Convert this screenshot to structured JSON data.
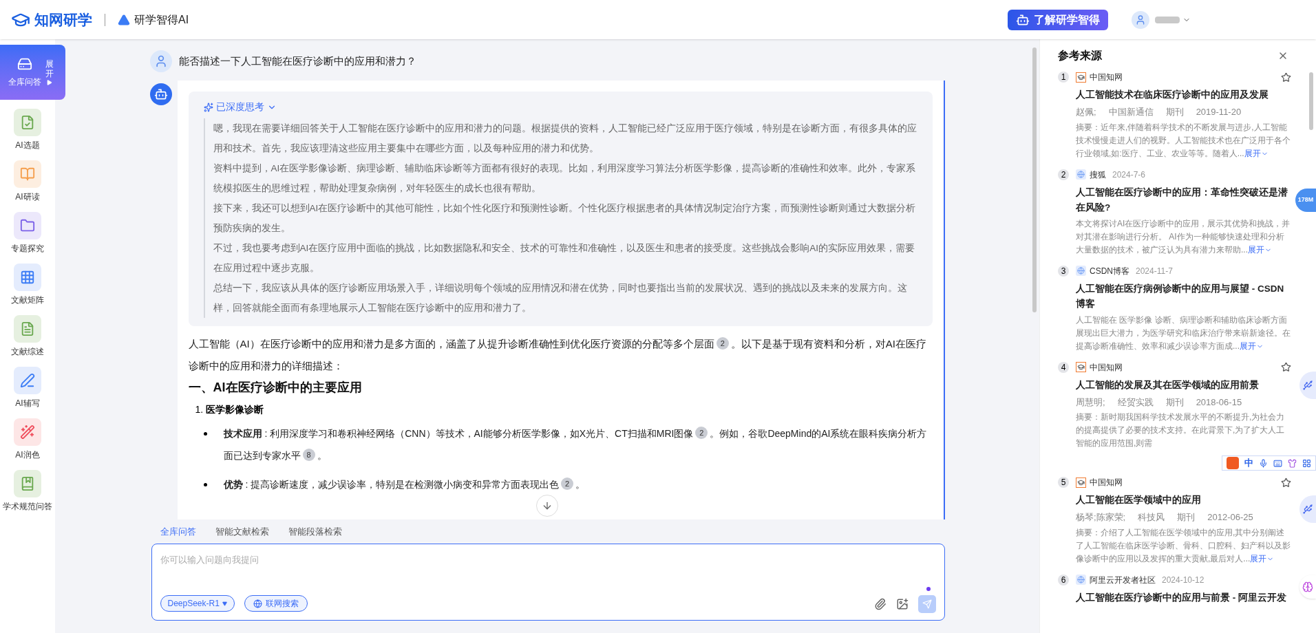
{
  "header": {
    "logo_text": "知网研学",
    "product": "研学智得AI",
    "promo_button": "了解研学智得"
  },
  "sidebar": {
    "expand_label": "展开",
    "items": [
      {
        "label": "全库问答",
        "kind": "library",
        "selected": true
      },
      {
        "label": "AI选题",
        "kind": "topic",
        "selected": false
      },
      {
        "label": "AI研读",
        "kind": "read",
        "selected": false
      },
      {
        "label": "专题探究",
        "kind": "folder",
        "selected": false
      },
      {
        "label": "文献矩阵",
        "kind": "matrix",
        "selected": false
      },
      {
        "label": "文献综述",
        "kind": "review",
        "selected": false
      },
      {
        "label": "AI辅写",
        "kind": "write",
        "selected": false
      },
      {
        "label": "AI润色",
        "kind": "polish",
        "selected": false
      },
      {
        "label": "学术规范问答",
        "kind": "norm",
        "selected": false
      }
    ]
  },
  "chat": {
    "question": "能否描述一下人工智能在医疗诊断中的应用和潜力？",
    "thinking": {
      "label": "已深度思考",
      "expanded": true,
      "paragraphs": [
        "嗯，我现在需要详细回答关于人工智能在医疗诊断中的应用和潜力的问题。根据提供的资料，人工智能已经广泛应用于医疗领域，特别是在诊断方面，有很多具体的应用和技术。首先，我应该理清这些应用主要集中在哪些方面，以及每种应用的潜力和优势。",
        "资料中提到，AI在医学影像诊断、病理诊断、辅助临床诊断等方面都有很好的表现。比如，利用深度学习算法分析医学影像，提高诊断的准确性和效率。此外，专家系统模拟医生的思维过程，帮助处理复杂病例，对年轻医生的成长也很有帮助。",
        "接下来，我还可以想到AI在医疗诊断中的其他可能性，比如个性化医疗和预测性诊断。个性化医疗根据患者的具体情况制定治疗方案，而预测性诊断则通过大数据分析预防疾病的发生。",
        "不过，我也要考虑到AI在医疗应用中面临的挑战，比如数据隐私和安全、技术的可靠性和准确性，以及医生和患者的接受度。这些挑战会影响AI的实际应用效果，需要在应用过程中逐步克服。",
        "总结一下，我应该从具体的医疗诊断应用场景入手，详细说明每个领域的应用情况和潜在优势，同时也要指出当前的发展状况、遇到的挑战以及未来的发展方向。这样，回答就能全面而有条理地展示人工智能在医疗诊断中的应用和潜力了。"
      ]
    },
    "answer": [
      {
        "kind": "paragraph",
        "segments": [
          {
            "text": "人工智能（AI）在医疗诊断中的应用和潜力是多方面的，涵盖了从提升诊断准确性到优化医疗资源的分配等多个层面"
          },
          {
            "cite": "2"
          },
          {
            "text": "。以下是基于现有资料和分析，对AI在医疗诊断中的应用和潜力的详细描述："
          }
        ]
      },
      {
        "kind": "heading",
        "text": "一、AI在医疗诊断中的主要应用"
      },
      {
        "kind": "numbered",
        "number": "1.",
        "text": "医学影像诊断"
      },
      {
        "kind": "bullet",
        "term": "技术应用",
        "segments": [
          {
            "text": " : 利用深度学习和卷积神经网络（CNN）等技术，AI能够分析医学影像，如X光片、CT扫描和MRI图像"
          },
          {
            "cite": "2"
          },
          {
            "text": "。例如，谷歌DeepMind的AI系统在眼科疾病分析方面已达到专家水平"
          },
          {
            "cite": "8"
          },
          {
            "text": "。"
          }
        ]
      },
      {
        "kind": "bullet",
        "term": "优势",
        "segments": [
          {
            "text": " : 提高诊断速度，减少误诊率，特别是在检测微小病变和异常方面表现出色"
          },
          {
            "cite": "2"
          },
          {
            "text": "。"
          }
        ]
      }
    ]
  },
  "composer": {
    "tabs": [
      {
        "label": "全库问答",
        "selected": true
      },
      {
        "label": "智能文献检索",
        "selected": false
      },
      {
        "label": "智能段落检索",
        "selected": false
      }
    ],
    "placeholder": "你可以输入问题向我提问",
    "model": "DeepSeek-R1",
    "web_search": "联网搜索"
  },
  "references": {
    "title": "参考来源",
    "items": [
      {
        "number": "1",
        "kind": "cnki",
        "source": "中国知网",
        "starred": false,
        "title": "人工智能技术在临床医疗诊断中的应用及发展",
        "meta": [
          "赵佩;",
          "中国新通信",
          "期刊",
          "2019-11-20"
        ],
        "abstract": "摘要：近年来,伴随着科学技术的不断发展与进步,人工智能技术慢慢走进人们的视野。人工智能技术也在广泛用于各个行业领域,如:医疗、工业、农业等等。随着人...",
        "expand": "展开"
      },
      {
        "number": "2",
        "kind": "web",
        "source": "搜狐",
        "date": "2024-7-6",
        "title": "人工智能在医疗诊断中的应用：革命性突破还是潜在风险?",
        "abstract": "本文将探讨AI在医疗诊断中的应用，展示其优势和挑战，并对其潜在影响进行分析。 AI作为一种能够快速处理和分析大量数据的技术，被广泛认为具有潜力来帮助...",
        "expand": "展开"
      },
      {
        "number": "3",
        "kind": "web",
        "source": "CSDN博客",
        "date": "2024-11-7",
        "title": "人工智能在医疗病例诊断中的应用与展望 - CSDN博客",
        "abstract": "人工智能在 医学影像 诊断、病理诊断和辅助临床诊断方面展现出巨大潜力，为医学研究和临床治疗带来崭新途径。在提高诊断准确性、效率和减少误诊率方面成...",
        "expand": "展开"
      },
      {
        "number": "4",
        "kind": "cnki",
        "source": "中国知网",
        "starred": false,
        "title": "人工智能的发展及其在医学领域的应用前景",
        "meta": [
          "周慧明;",
          "经贸实践",
          "期刊",
          "2018-06-15"
        ],
        "abstract": "摘要：新时期我国科学技术发展水平的不断提升,为社会力的提高提供了必要的技术支持。在此背景下,为了扩大人工智能的应用范围,则需"
      },
      {
        "number": "5",
        "kind": "cnki",
        "source": "中国知网",
        "starred": false,
        "title": "人工智能在医学领域中的应用",
        "meta": [
          "杨琴;陈家荣;",
          "科技风",
          "期刊",
          "2012-06-25"
        ],
        "abstract": "摘要：介绍了人工智能在医学领域中的应用,其中分别阐述了人工智能在临床医学诊断、骨科、口腔科、妇产科以及影像诊断中的应用以及发挥的重大贡献,最后对人...",
        "expand": "展开"
      },
      {
        "number": "6",
        "kind": "web",
        "source": "阿里云开发者社区",
        "date": "2024-10-12",
        "title": "人工智能在医疗诊断中的应用与前景 - 阿里云开发"
      }
    ]
  },
  "overlays": {
    "memory_badge": "178M",
    "ime_label": "中"
  }
}
